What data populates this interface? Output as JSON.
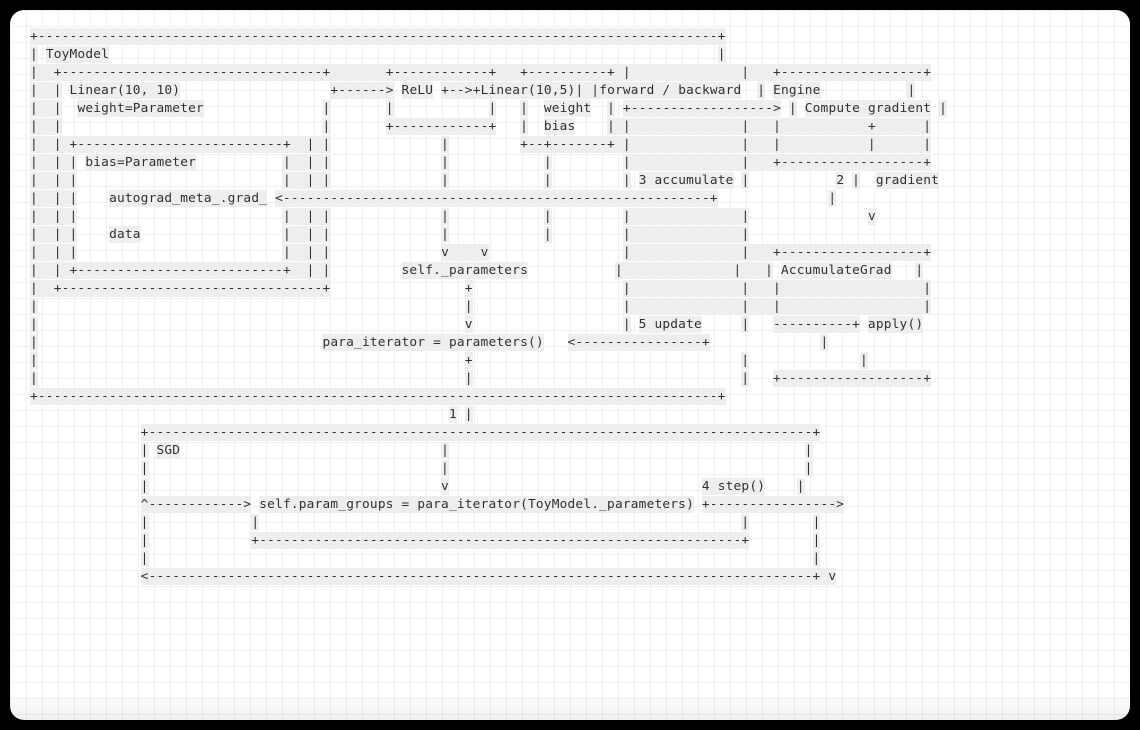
{
  "diagram": {
    "title": "ToyModel",
    "blocks": {
      "linear1": {
        "name": "Linear(10, 10)",
        "fields": [
          "weight=Parameter",
          "bias=Parameter",
          "autograd_meta_.grad_",
          "data"
        ]
      },
      "relu": {
        "name": "ReLU"
      },
      "linear2": {
        "name": "Linear(10,5)",
        "fields": [
          "weight",
          "bias"
        ]
      },
      "engine": {
        "name": "Engine",
        "fields": [
          "Compute gradient"
        ]
      },
      "accumulate_grad": {
        "name": "AccumulateGrad",
        "method": "apply()"
      },
      "sgd": {
        "name": "SGD",
        "field": "self.param_groups = para_iterator(ToyModel._parameters)",
        "method": "step()"
      }
    },
    "labels": {
      "forward_backward": "forward / backward",
      "self_parameters": "self._parameters",
      "para_iterator": "para_iterator = parameters()",
      "gradient": "gradient"
    },
    "steps": {
      "s1": "1",
      "s2": "2",
      "s3_accumulate": "3 accumulate",
      "s4_step": "4 step()",
      "s5_update": "5 update"
    },
    "ascii_rows": [
      "+--------------------------------------------------------------------------------------+",
      "| ToyModel                                                                             |",
      "|  +---------------------------------+       +------------+  +----------+              |   +------------------+",
      "|  | Linear(10, 10)                   +------> ReLU +-->+Linear(10,5)| |forward / backward |   | Engine           |",
      "|  |  weight=Parameter               |       |            |  |  weight  | +------------------> | Compute gradient |",
      "|  |                                 |       +------------+  |  bias    | |              |   |           +      |",
      "|  | +--------------------------+ | |               |        +--+-------+ |              |   |           |      |",
      "|  | | bias=Parameter            | | |               |            |        |              |   +------------------+",
      "|  | |                           | | |               |            |        | 3 accumulate |            2 |  gradient",
      "|  | |   autograd_meta_.grad_ <------------------------------------------------------+              |",
      "|  | |                           | | |               |            |        |              |               v",
      "|  | |   data                    | | |               |            |        |              |",
      "|  | |                           | | |               v   v        |              |   +------------------+",
      "|  | +--------------------------+ | |        self._parameters     |              |   | AccumulateGrad   |",
      "|  +---------------------------------+               +                      |   |                  |",
      "|                                                    |                                  |   |                  |",
      "|                                                    v                      | 5 update  |   +---------+ apply()",
      "|                                 para_iterator = parameters()   <----------------+              |",
      "|                                                    +                                  |              |",
      "|                                                    |                                  |   +------------------+",
      "+--------------------------------------------------------------------------------------+",
      "                                                   1 |",
      "              +------------------------------------------------------------------------------------+",
      "              | SGD                                  |                                             |",
      "              |                                      |                                             |",
      "              |                                      v                                 4 step()   |",
      "              ^------------> self.param_groups = para_iterator(ToyModel._parameters) +---------------->",
      "              |              |                                                            |        |",
      "              |              +------------------------------------------------------------+        |",
      "              |                                                                                     |",
      "              <-------------------------------------------------------------------------------------+ v"
    ]
  }
}
